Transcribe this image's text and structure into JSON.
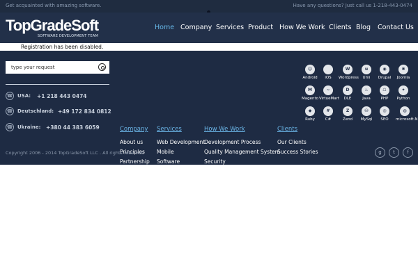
{
  "topbar": {
    "tagline": "Get acquainted with amazing software.",
    "contact": "Have any questions? Just call us 1-218-443-0474"
  },
  "header": {
    "logo_name": "TopGradeSoft",
    "logo_tagline": "SOFTWARE DEVELOPMENT TEAM",
    "nav": [
      {
        "label": "Home",
        "active": true
      },
      {
        "label": "Company",
        "active": false
      },
      {
        "label": "Services",
        "active": false
      },
      {
        "label": "Product",
        "active": false
      },
      {
        "label": "How We Work",
        "active": false
      },
      {
        "label": "Clients",
        "active": false
      },
      {
        "label": "Blog",
        "active": false
      },
      {
        "label": "Contact Us",
        "active": false
      }
    ]
  },
  "notice": "Registration has been disabled.",
  "search": {
    "placeholder": "type your request",
    "icon": "search-icon"
  },
  "phones": [
    {
      "label": "USA:",
      "number": "+1 218 443 0474"
    },
    {
      "label": "Deutschland:",
      "number": "+49 172 834 0812"
    },
    {
      "label": "Ukraine:",
      "number": "+380 44 383 6059"
    }
  ],
  "technologies": [
    [
      "Android",
      "iOS",
      "Wordpress",
      "Umi",
      "Drupal",
      "Joomla"
    ],
    [
      "Magento",
      "VirtueMart",
      "DLE",
      "Java",
      "PHP",
      "Python"
    ],
    [
      "Ruby",
      "C#",
      "Zend",
      "MySql",
      "SEO",
      "microsoft.NET"
    ]
  ],
  "columns": [
    {
      "heading": "Company",
      "items": [
        "About us",
        "Principles",
        "Partnership"
      ]
    },
    {
      "heading": "Services",
      "items": [
        "Web Development",
        "Mobile",
        "Software"
      ]
    },
    {
      "heading": "How We Work",
      "items": [
        "Development Process",
        "Quality Management System",
        "Security"
      ]
    },
    {
      "heading": "Clients",
      "items": [
        "Our Clients",
        "Success Stories"
      ]
    }
  ],
  "copyright": "Copyright 2006 - 2014 TopGradeSoft LLC . All rights reserved",
  "social": [
    "google-plus-icon",
    "twitter-icon",
    "facebook-icon"
  ],
  "colors": {
    "header_bg": "#223049",
    "footer_bg": "#1e2b43",
    "accent": "#67b8e8"
  }
}
